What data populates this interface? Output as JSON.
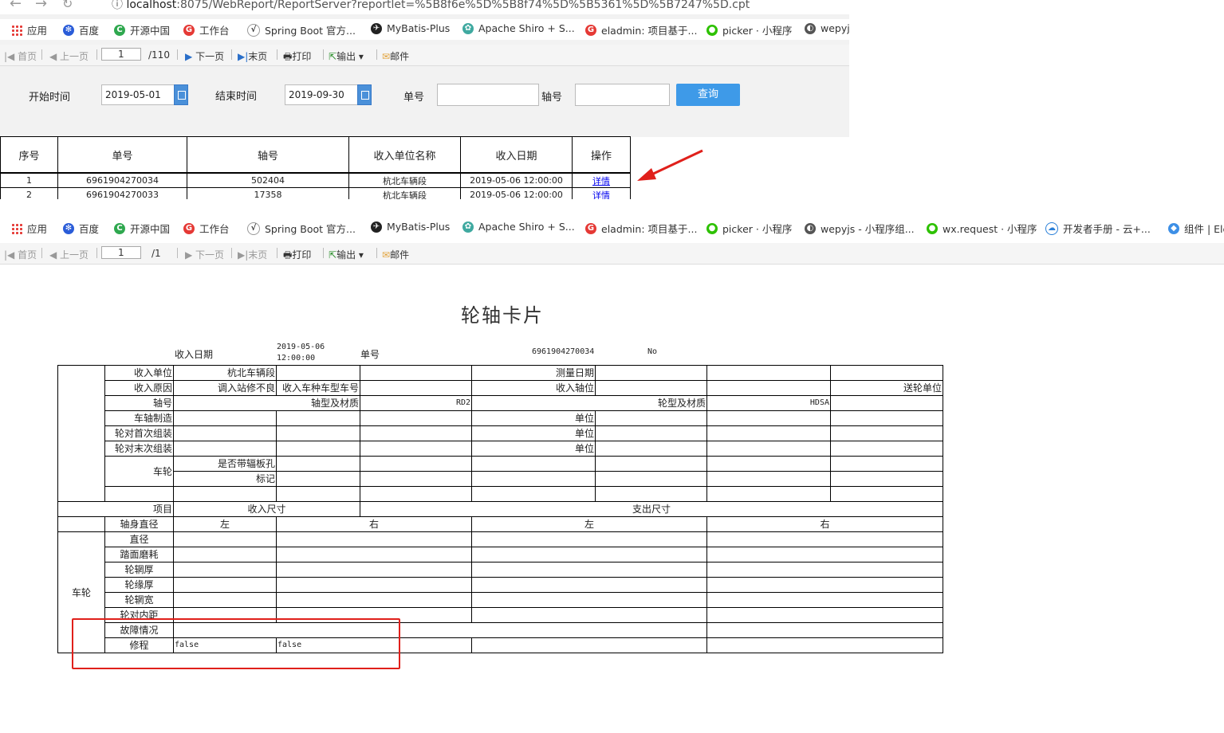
{
  "browser": {
    "url_host": "localhost",
    "url_rest": ":8075/WebReport/ReportServer?reportlet=%5B8f6e%5D%5B8f74%5D%5B5361%5D%5B7247%5D.cpt",
    "bookmarks_top": [
      "应用",
      "百度",
      "开源中国",
      "工作台",
      "Spring Boot 官方...",
      "MyBatis-Plus",
      "Apache Shiro + S...",
      "eladmin: 项目基于...",
      "picker · 小程序",
      "wepyj"
    ],
    "bookmarks_bottom": [
      "应用",
      "百度",
      "开源中国",
      "工作台",
      "Spring Boot 官方...",
      "MyBatis-Plus",
      "Apache Shiro + S...",
      "eladmin: 项目基于...",
      "picker · 小程序",
      "wepyjs - 小程序组...",
      "wx.request · 小程序",
      "开发者手册 - 云+...",
      "组件 | Ele"
    ]
  },
  "toolbar_top": {
    "first": "首页",
    "prev": "上一页",
    "page": "1",
    "total": "/110",
    "next": "下一页",
    "last": "末页",
    "print": "打印",
    "export": "输出",
    "mail": "邮件"
  },
  "toolbar_bottom": {
    "first": "首页",
    "prev": "上一页",
    "page": "1",
    "total": "/1",
    "next": "下一页",
    "last": "末页",
    "print": "打印",
    "export": "输出",
    "mail": "邮件"
  },
  "query": {
    "start_label": "开始时间",
    "start_value": "2019-05-01",
    "end_label": "结束时间",
    "end_value": "2019-09-30",
    "order_label": "单号",
    "axle_label": "轴号",
    "search_button": "查询"
  },
  "results": {
    "headers": [
      "序号",
      "单号",
      "轴号",
      "收入单位名称",
      "收入日期",
      "操作"
    ],
    "rows": [
      [
        "1",
        "6961904270034",
        "502404",
        "杭北车辆段",
        "2019-05-06 12:00:00",
        "详情"
      ],
      [
        "2",
        "6961904270033",
        "17358",
        "杭北车辆段",
        "2019-05-06 12:00:00",
        "详情"
      ]
    ]
  },
  "card": {
    "title": "轮轴卡片",
    "receive_date_label": "收入日期",
    "receive_date_1": "2019-05-06",
    "receive_date_2": "12:00:00",
    "order_label": "单号",
    "order_value": "6961904270034",
    "no_label": "No",
    "r_unit_label": "收入单位",
    "r_unit_value": "杭北车辆段",
    "measure_date": "测量日期",
    "r_reason_label": "收入原因",
    "r_reason_value": "调入站修不良",
    "car_type": "收入车种车型车号",
    "r_axle_pos": "收入轴位",
    "send_unit": "送轮单位",
    "axle_no": "轴号",
    "axle_type_label": "轴型及材质",
    "axle_type_value": "RD2",
    "wheel_type_label": "轮型及材质",
    "wheel_type_value": "HDSA",
    "axle_make": "车轴制造",
    "unit1": "单位",
    "first_assembly": "轮对首次组装",
    "unit2": "单位",
    "last_assembly": "轮对末次组装",
    "unit3": "单位",
    "wheel": "车轮",
    "spoke_hole": "是否带辐板孔",
    "mark": "标记",
    "item": "项目",
    "in_size": "收入尺寸",
    "out_size": "支出尺寸",
    "axle_diameter": "轴身直径",
    "left": "左",
    "right": "右",
    "wheel_group": "车轮",
    "diameter": "直径",
    "tread_wear": "踏面磨耗",
    "rim_thick": "轮辋厚",
    "flange_thick": "轮缘厚",
    "rim_width": "轮辋宽",
    "inner_distance": "轮对内距",
    "fault": "故障情况",
    "repair": "修程",
    "repair_left": "false",
    "repair_right": "false"
  }
}
